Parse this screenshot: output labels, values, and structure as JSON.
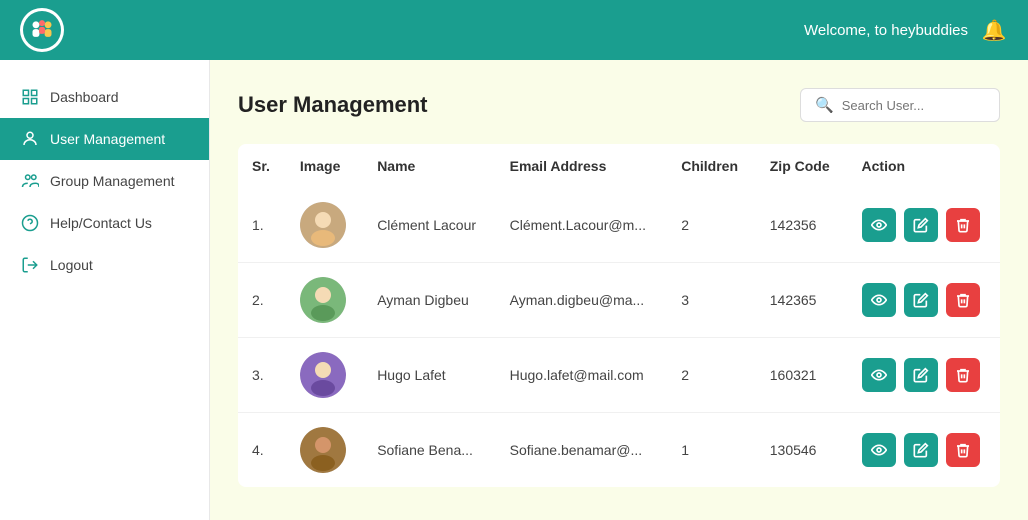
{
  "header": {
    "welcome_text": "Welcome, to heybuddies",
    "logo_alt": "HeyBuddies"
  },
  "sidebar": {
    "items": [
      {
        "id": "dashboard",
        "label": "Dashboard",
        "icon": "dashboard",
        "active": false
      },
      {
        "id": "user-management",
        "label": "User Management",
        "icon": "user",
        "active": true
      },
      {
        "id": "group-management",
        "label": "Group Management",
        "icon": "group",
        "active": false
      },
      {
        "id": "help-contact",
        "label": "Help/Contact Us",
        "icon": "help",
        "active": false
      },
      {
        "id": "logout",
        "label": "Logout",
        "icon": "logout",
        "active": false
      }
    ]
  },
  "content": {
    "page_title": "User Management",
    "search_placeholder": "Search User...",
    "table": {
      "columns": [
        "Sr.",
        "Image",
        "Name",
        "Email Address",
        "Children",
        "Zip Code",
        "Action"
      ],
      "rows": [
        {
          "sr": "1.",
          "name": "Clément Lacour",
          "email": "Clément.Lacour@m...",
          "children": "2",
          "zip": "142356",
          "avatar_color": "#b5651d"
        },
        {
          "sr": "2.",
          "name": "Ayman Digbeu",
          "email": "Ayman.digbeu@ma...",
          "children": "3",
          "zip": "142365",
          "avatar_color": "#4a8c4a"
        },
        {
          "sr": "3.",
          "name": "Hugo Lafet",
          "email": "Hugo.lafet@mail.com",
          "children": "2",
          "zip": "160321",
          "avatar_color": "#6a5acd"
        },
        {
          "sr": "4.",
          "name": "Sofiane Bena...",
          "email": "Sofiane.benamar@...",
          "children": "1",
          "zip": "130546",
          "avatar_color": "#8b6914"
        }
      ]
    }
  }
}
